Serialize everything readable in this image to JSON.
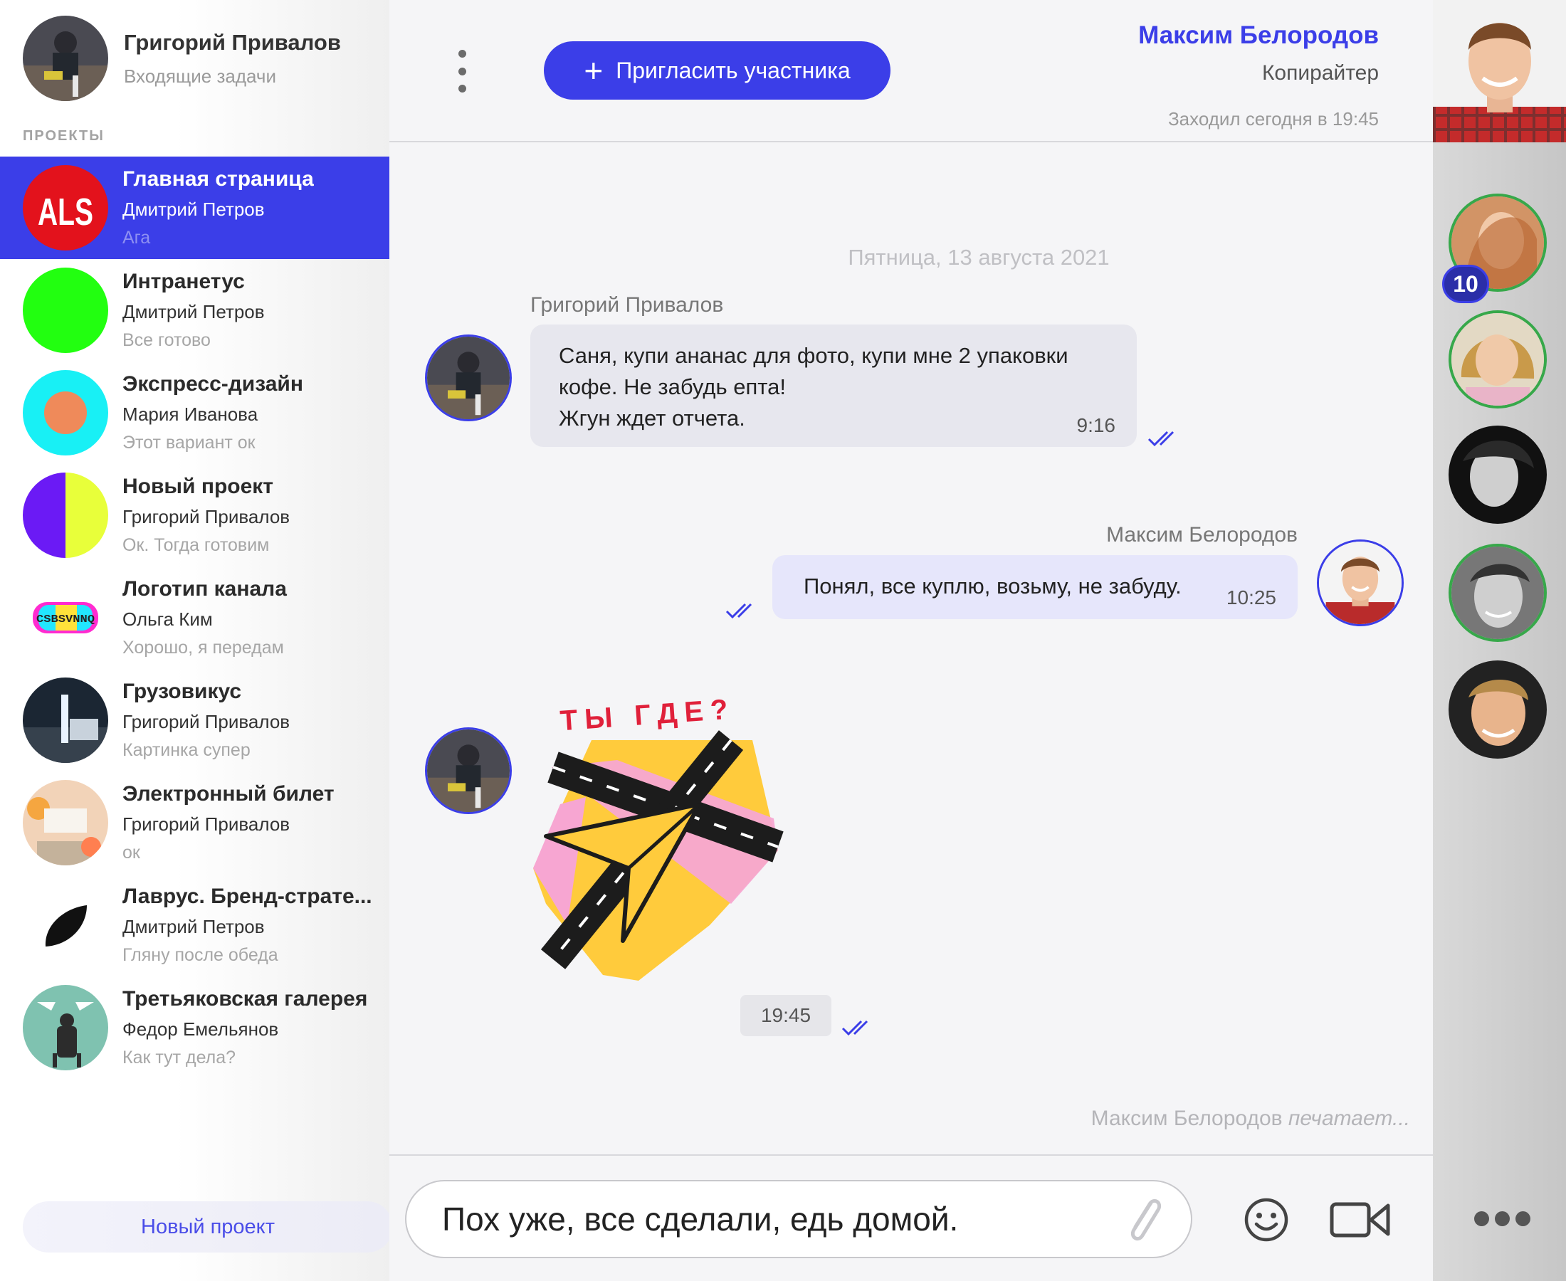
{
  "current_user": {
    "name": "Григорий Привалов",
    "subtitle": "Входящие задачи"
  },
  "sidebar": {
    "section_label": "ПРОЕКТЫ",
    "projects": [
      {
        "title": "Главная страница",
        "author": "Дмитрий Петров",
        "last": "Ага",
        "logo_text": "ALS",
        "active": true
      },
      {
        "title": "Интранетус",
        "author": "Дмитрий Петров",
        "last": "Все готово"
      },
      {
        "title": "Экспресс-дизайн",
        "author": "Мария Иванова",
        "last": "Этот вариант ок"
      },
      {
        "title": "Новый проект",
        "author": "Григорий Привалов",
        "last": "Ок. Тогда готовим"
      },
      {
        "title": "Логотип канала",
        "author": "Ольга Ким",
        "last": "Хорошо, я передам",
        "logo_text": "CSBSVNNQ"
      },
      {
        "title": "Грузовикус",
        "author": "Григорий Привалов",
        "last": "Картинка супер"
      },
      {
        "title": "Электронный билет",
        "author": "Григорий Привалов",
        "last": "ок"
      },
      {
        "title": "Лаврус. Бренд-страте...",
        "author": "Дмитрий Петров",
        "last": "Гляну после обеда"
      },
      {
        "title": "Третьяковская галерея",
        "author": "Федор Емельянов",
        "last": "Как тут дела?"
      }
    ],
    "new_project_label": "Новый проект"
  },
  "chat": {
    "invite_label": "Пригласить участника",
    "peer": {
      "name": "Максим Белородов",
      "role": "Копирайтер",
      "seen": "Заходил сегодня в 19:45"
    },
    "date_separator": "Пятница, 13 августа 2021",
    "messages": [
      {
        "sender": "Григорий Привалов",
        "lines": [
          "Саня, купи ананас для фото, купи мне 2 упаковки",
          "кофе. Не забудь епта!",
          "Жгун ждет отчета."
        ],
        "time": "9:16"
      },
      {
        "sender": "Максим Белородов",
        "lines": [
          "Понял, все куплю, возьму, не забуду."
        ],
        "time": "10:25"
      },
      {
        "sticker_caption": "ТЫ ГДЕ?",
        "time": "19:45"
      }
    ],
    "typing": {
      "name": "Максим Белородов",
      "status": "печатает..."
    },
    "composer_value": "Пох уже, все сделали, едь домой."
  },
  "members": {
    "unread_badge": "10"
  },
  "colors": {
    "accent": "#3b3ee8",
    "online": "#37a84a",
    "sticker_text": "#e0203a"
  },
  "icons": [
    "more-vertical-icon",
    "plus-icon",
    "double-check-icon",
    "paperclip-icon",
    "smile-icon",
    "video-camera-icon",
    "more-horizontal-icon"
  ]
}
